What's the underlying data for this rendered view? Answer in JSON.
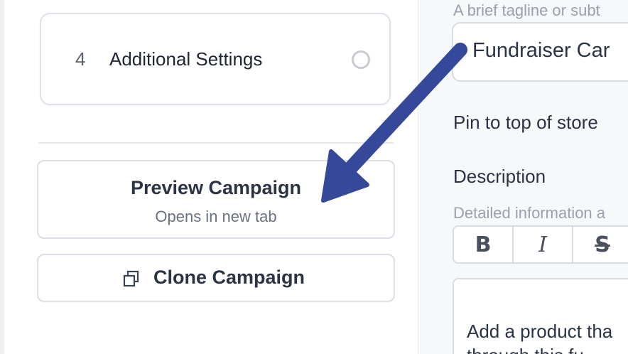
{
  "steps": [
    {
      "number": "4",
      "label": "Additional Settings",
      "status": "incomplete"
    }
  ],
  "actions": {
    "preview": {
      "title": "Preview Campaign",
      "subtitle": "Opens in new tab"
    },
    "clone": {
      "label": "Clone Campaign",
      "icon": "copy-icon"
    }
  },
  "form": {
    "tagline": {
      "help": "A brief tagline or subt",
      "value": "Fundraiser Car"
    },
    "pin": {
      "label": "Pin to top of store"
    },
    "description": {
      "label": "Description",
      "help": "Detailed information a",
      "toolbar": [
        {
          "name": "bold",
          "glyph": "B"
        },
        {
          "name": "italic",
          "glyph": "I"
        },
        {
          "name": "strikethrough",
          "glyph": "S"
        }
      ],
      "content_line1": "Add a product tha",
      "content_line2": "through this fu"
    }
  },
  "annotation": {
    "arrow_color": "#36489a"
  },
  "colors": {
    "border": "#dcdfe5",
    "text": "#2b3345",
    "muted": "#6b7180",
    "panel": "#f7f8fa"
  }
}
